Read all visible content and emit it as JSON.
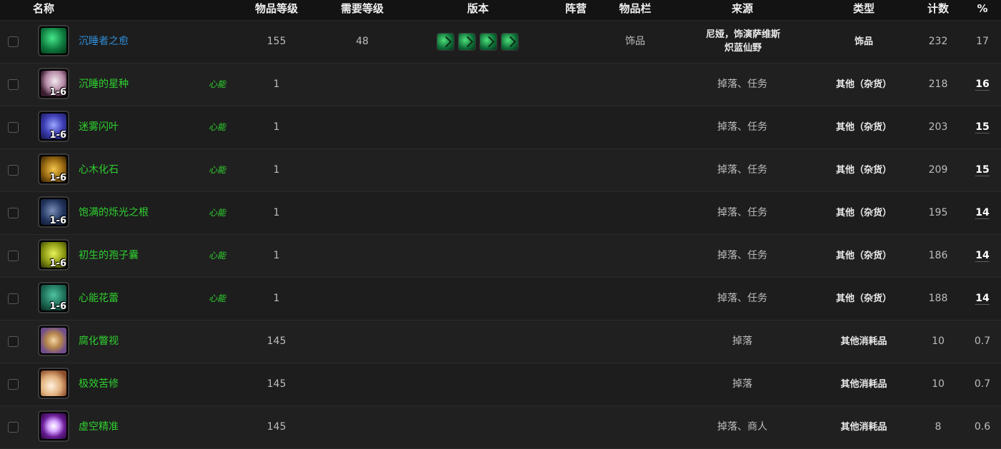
{
  "headers": {
    "name": "名称",
    "item_level": "物品等级",
    "req_level": "需要等级",
    "version": "版本",
    "faction": "阵营",
    "slot": "物品栏",
    "source": "来源",
    "type": "类型",
    "count": "计数",
    "pct": "%"
  },
  "rows": [
    {
      "name": "沉睡者之愈",
      "tag": "",
      "ilvl": "155",
      "req": "48",
      "slot": "饰品",
      "source": "",
      "source_line1": "尼娅，饰演萨维斯",
      "source_line2": "炽蓝仙野",
      "type": "饰品",
      "count": "232",
      "pct": "17",
      "stack": "",
      "icon": "trinket-icon"
    },
    {
      "name": "沉睡的星种",
      "tag": "心能",
      "ilvl": "1",
      "req": "",
      "slot": "",
      "source": "掉落、任务",
      "type": "其他（杂货）",
      "count": "218",
      "pct": "16",
      "stack": "1-6",
      "icon": "seed-icon"
    },
    {
      "name": "迷雾闪叶",
      "tag": "心能",
      "ilvl": "1",
      "req": "",
      "slot": "",
      "source": "掉落、任务",
      "type": "其他（杂货）",
      "count": "203",
      "pct": "15",
      "stack": "1-6",
      "icon": "leaf-icon"
    },
    {
      "name": "心木化石",
      "tag": "心能",
      "ilvl": "1",
      "req": "",
      "slot": "",
      "source": "掉落、任务",
      "type": "其他（杂货）",
      "count": "209",
      "pct": "15",
      "stack": "1-6",
      "icon": "fossil-icon"
    },
    {
      "name": "饱满的烁光之根",
      "tag": "心能",
      "ilvl": "1",
      "req": "",
      "slot": "",
      "source": "掉落、任务",
      "type": "其他（杂货）",
      "count": "195",
      "pct": "14",
      "stack": "1-6",
      "icon": "root-icon"
    },
    {
      "name": "初生的孢子囊",
      "tag": "心能",
      "ilvl": "1",
      "req": "",
      "slot": "",
      "source": "掉落、任务",
      "type": "其他（杂货）",
      "count": "186",
      "pct": "14",
      "stack": "1-6",
      "icon": "spore-sac-icon"
    },
    {
      "name": "心能花蕾",
      "tag": "心能",
      "ilvl": "1",
      "req": "",
      "slot": "",
      "source": "掉落、任务",
      "type": "其他（杂货）",
      "count": "188",
      "pct": "14",
      "stack": "1-6",
      "icon": "flower-bud-icon"
    },
    {
      "name": "腐化瞥视",
      "tag": "",
      "ilvl": "145",
      "req": "",
      "slot": "",
      "source": "掉落",
      "type": "其他消耗品",
      "count": "10",
      "pct": "0.7",
      "stack": "",
      "icon": "eye-icon"
    },
    {
      "name": "极效苦修",
      "tag": "",
      "ilvl": "145",
      "req": "",
      "slot": "",
      "source": "掉落",
      "type": "其他消耗品",
      "count": "10",
      "pct": "0.7",
      "stack": "",
      "icon": "scroll-icon"
    },
    {
      "name": "虚空精准",
      "tag": "",
      "ilvl": "145",
      "req": "",
      "slot": "",
      "source": "掉落、商人",
      "type": "其他消耗品",
      "count": "8",
      "pct": "0.6",
      "stack": "",
      "icon": "void-rune-icon"
    }
  ],
  "version_icons": [
    "version-icon",
    "version-icon",
    "version-icon",
    "version-icon"
  ],
  "colors": {
    "link_blue": "#2f8ed8",
    "link_green": "#2fd12f",
    "background": "#1b1b1b"
  }
}
